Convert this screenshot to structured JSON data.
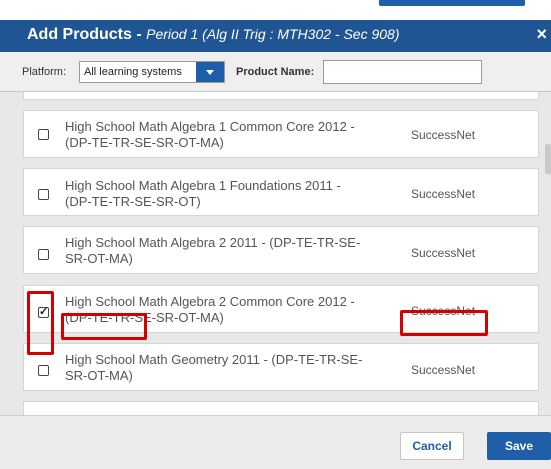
{
  "dialog": {
    "title": "Add Products",
    "separator": " - ",
    "subtitle": "Period 1 (Alg II Trig : MTH302 - Sec 908)",
    "close_icon": "×"
  },
  "filters": {
    "platform_label": "Platform:",
    "platform_selected": "All learning systems",
    "product_name_label": "Product Name:",
    "product_name_value": ""
  },
  "products": [
    {
      "name": "High School Math Algebra 1 Common Core 2012 - (DP-TE-TR-SE-SR-OT-MA)",
      "platform": "SuccessNet",
      "checked": false
    },
    {
      "name": "High School Math Algebra 1 Foundations 2011 - (DP-TE-TR-SE-SR-OT)",
      "platform": "SuccessNet",
      "checked": false
    },
    {
      "name": "High School Math Algebra 2 2011 - (DP-TE-TR-SE-SR-OT-MA)",
      "platform": "SuccessNet",
      "checked": false
    },
    {
      "name": "High School Math Algebra 2 Common Core 2012 - (DP-TE-TR-SE-SR-OT-MA)",
      "platform": "SuccessNet",
      "checked": true
    },
    {
      "name": "High School Math Geometry 2011 - (DP-TE-TR-SE-SR-OT-MA)",
      "platform": "SuccessNet",
      "checked": false
    }
  ],
  "footer": {
    "cancel_label": "Cancel",
    "save_label": "Save"
  },
  "colors": {
    "header": "#1f5593",
    "accent": "#1f5ea8",
    "highlight": "#d40000"
  }
}
